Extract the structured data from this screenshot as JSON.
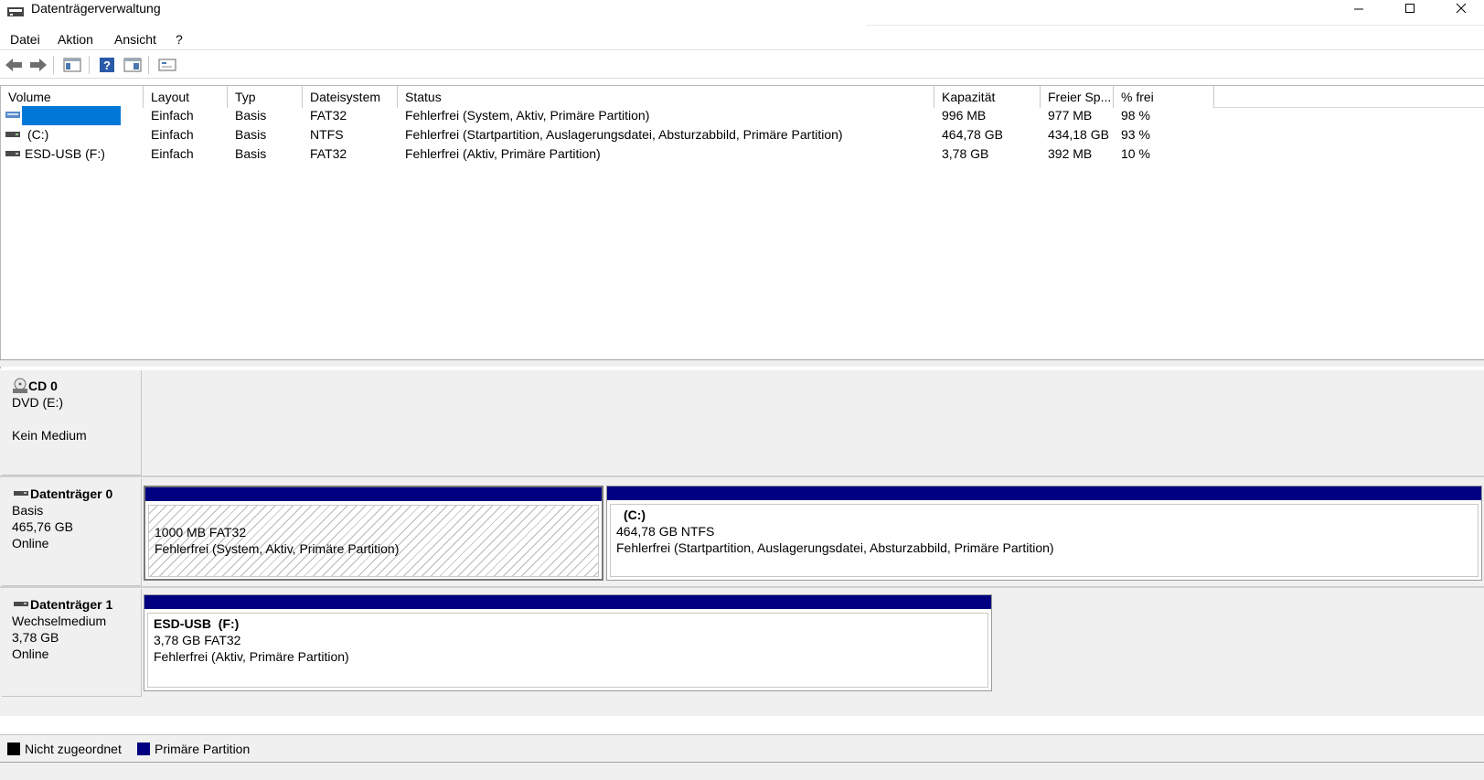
{
  "window": {
    "title": "Datenträgerverwaltung",
    "controls": {
      "minimize": "—",
      "maximize": "☐",
      "close": "✕"
    }
  },
  "menu": [
    "Datei",
    "Aktion",
    "Ansicht",
    "?"
  ],
  "toolbar": [
    "back-icon",
    "forward-icon",
    "panel-icon",
    "help-icon",
    "properties-icon",
    "console-icon"
  ],
  "volume_table": {
    "columns": [
      "Volume",
      "Layout",
      "Typ",
      "Dateisystem",
      "Status",
      "Kapazität",
      "Freier Sp...",
      "% frei"
    ],
    "rows": [
      {
        "volume": "",
        "layout": "Einfach",
        "typ": "Basis",
        "dateisystem": "FAT32",
        "status": "Fehlerfrei (System, Aktiv, Primäre Partition)",
        "kapazitaet": "996 MB",
        "frei": "977 MB",
        "prozent": "98 %",
        "selected": true
      },
      {
        "volume": "(C:)",
        "layout": "Einfach",
        "typ": "Basis",
        "dateisystem": "NTFS",
        "status": "Fehlerfrei (Startpartition, Auslagerungsdatei, Absturzabbild, Primäre Partition)",
        "kapazitaet": "464,78 GB",
        "frei": "434,18 GB",
        "prozent": "93 %",
        "selected": false
      },
      {
        "volume": "ESD-USB (F:)",
        "layout": "Einfach",
        "typ": "Basis",
        "dateisystem": "FAT32",
        "status": "Fehlerfrei (Aktiv, Primäre Partition)",
        "kapazitaet": "3,78 GB",
        "frei": "392 MB",
        "prozent": "10 %",
        "selected": false
      }
    ]
  },
  "disks": {
    "cd0": {
      "name": "CD 0",
      "type": "DVD (E:)",
      "status": "Kein Medium"
    },
    "disk0": {
      "name": "Datenträger 0",
      "type": "Basis",
      "size": "465,76 GB",
      "status": "Online",
      "p1": {
        "title": "",
        "size_fs": "1000 MB FAT32",
        "status": "Fehlerfrei (System, Aktiv, Primäre Partition)"
      },
      "p2": {
        "title": "(C:)",
        "size_fs": "464,78 GB NTFS",
        "status": "Fehlerfrei (Startpartition, Auslagerungsdatei, Absturzabbild, Primäre Partition)"
      }
    },
    "disk1": {
      "name": "Datenträger 1",
      "type": "Wechselmedium",
      "size": "3,78 GB",
      "status": "Online",
      "p1": {
        "title": "ESD-USB  (F:)",
        "size_fs": "3,78 GB FAT32",
        "status": "Fehlerfrei (Aktiv, Primäre Partition)"
      }
    }
  },
  "legend": [
    {
      "label": "Nicht zugeordnet",
      "color": "#000000"
    },
    {
      "label": "Primäre Partition",
      "color": "#000080"
    }
  ],
  "colors": {
    "selection": "#0078d7",
    "primary_partition": "#000080",
    "unallocated": "#000000"
  }
}
